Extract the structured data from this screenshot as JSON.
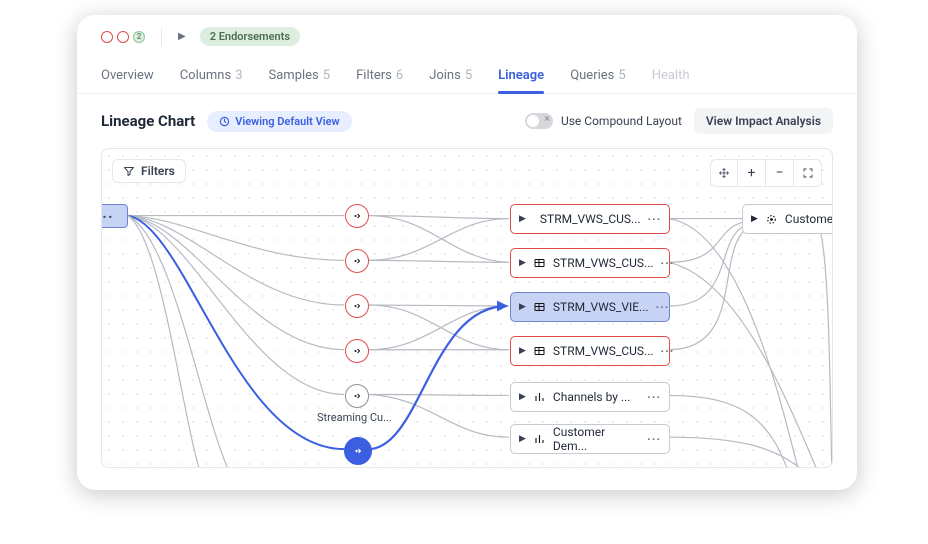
{
  "badges": {
    "count": "2",
    "endorsements": "2 Endorsements"
  },
  "tabs": {
    "overview": "Overview",
    "columns": {
      "label": "Columns",
      "count": "3"
    },
    "samples": {
      "label": "Samples",
      "count": "5"
    },
    "filters": {
      "label": "Filters",
      "count": "6"
    },
    "joins": {
      "label": "Joins",
      "count": "5"
    },
    "lineage": "Lineage",
    "queries": {
      "label": "Queries",
      "count": "5"
    },
    "health": "Health"
  },
  "header": {
    "title": "Lineage Chart",
    "viewing": "Viewing Default View",
    "compound": "Use Compound Layout",
    "impact": "View Impact Analysis"
  },
  "canvas": {
    "filters": "Filters",
    "hub_label": "Streaming Cu...",
    "cards": [
      "STRM_VWS_CUS...",
      "STRM_VWS_CUS...",
      "STRM_VWS_VIE...",
      "STRM_VWS_CUS...",
      "Channels by ...",
      "Customer Dem..."
    ],
    "dest": "Customer"
  }
}
